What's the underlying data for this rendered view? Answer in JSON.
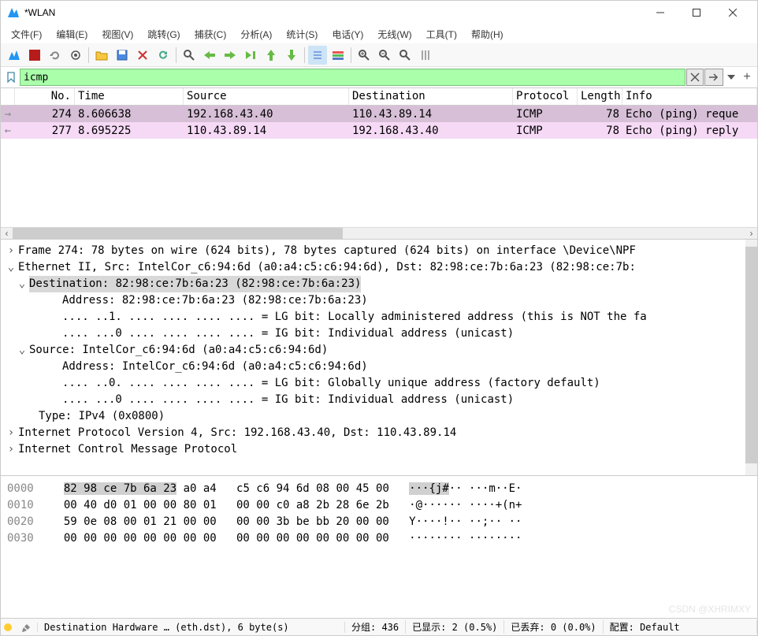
{
  "window": {
    "title": "*WLAN"
  },
  "menu": [
    "文件(F)",
    "编辑(E)",
    "视图(V)",
    "跳转(G)",
    "捕获(C)",
    "分析(A)",
    "统计(S)",
    "电话(Y)",
    "无线(W)",
    "工具(T)",
    "帮助(H)"
  ],
  "filter": {
    "value": "icmp"
  },
  "columns": [
    "No.",
    "Time",
    "Source",
    "Destination",
    "Protocol",
    "Length",
    "Info"
  ],
  "packets": [
    {
      "marker": "→",
      "no": "274",
      "time": "8.606638",
      "src": "192.168.43.40",
      "dst": "110.43.89.14",
      "proto": "ICMP",
      "len": "78",
      "info": "Echo (ping) reque",
      "cls": "req"
    },
    {
      "marker": "←",
      "no": "277",
      "time": "8.695225",
      "src": "110.43.89.14",
      "dst": "192.168.43.40",
      "proto": "ICMP",
      "len": "78",
      "info": "Echo (ping) reply",
      "cls": "rep"
    }
  ],
  "tree": {
    "frame": "Frame 274: 78 bytes on wire (624 bits), 78 bytes captured (624 bits) on interface \\Device\\NPF",
    "eth": "Ethernet II, Src: IntelCor_c6:94:6d (a0:a4:c5:c6:94:6d), Dst: 82:98:ce:7b:6a:23 (82:98:ce:7b:",
    "eth_dst": "Destination: 82:98:ce:7b:6a:23 (82:98:ce:7b:6a:23)",
    "eth_dst_addr": "Address: 82:98:ce:7b:6a:23 (82:98:ce:7b:6a:23)",
    "eth_dst_lg": ".... ..1. .... .... .... .... = LG bit: Locally administered address (this is NOT the fa",
    "eth_dst_ig": ".... ...0 .... .... .... .... = IG bit: Individual address (unicast)",
    "eth_src": "Source: IntelCor_c6:94:6d (a0:a4:c5:c6:94:6d)",
    "eth_src_addr": "Address: IntelCor_c6:94:6d (a0:a4:c5:c6:94:6d)",
    "eth_src_lg": ".... ..0. .... .... .... .... = LG bit: Globally unique address (factory default)",
    "eth_src_ig": ".... ...0 .... .... .... .... = IG bit: Individual address (unicast)",
    "eth_type": "Type: IPv4 (0x0800)",
    "ip": "Internet Protocol Version 4, Src: 192.168.43.40, Dst: 110.43.89.14",
    "icmp": "Internet Control Message Protocol"
  },
  "hex": [
    {
      "off": "0000",
      "b1": "82 98 ce 7b 6a 23 a0 a4",
      "b2": "c5 c6 94 6d 08 00 45 00",
      "asc": "···{j#·· ···m··E·"
    },
    {
      "off": "0010",
      "b1": "00 40 d0 01 00 00 80 01",
      "b2": "00 00 c0 a8 2b 28 6e 2b",
      "asc": "·@······ ····+(n+"
    },
    {
      "off": "0020",
      "b1": "59 0e 08 00 01 21 00 00",
      "b2": "00 00 3b be bb 20 00 00",
      "asc": "Y····!·· ··;·· ··"
    },
    {
      "off": "0030",
      "b1": "00 00 00 00 00 00 00 00",
      "b2": "00 00 00 00 00 00 00 00",
      "asc": "········ ········"
    }
  ],
  "status": {
    "field": "Destination Hardware … (eth.dst), 6 byte(s)",
    "packets": "分组: 436",
    "displayed": "已显示: 2 (0.5%)",
    "dropped": "已丢弃: 0 (0.0%)",
    "profile": "配置: Default"
  },
  "watermark": "CSDN @XHRIMXY"
}
